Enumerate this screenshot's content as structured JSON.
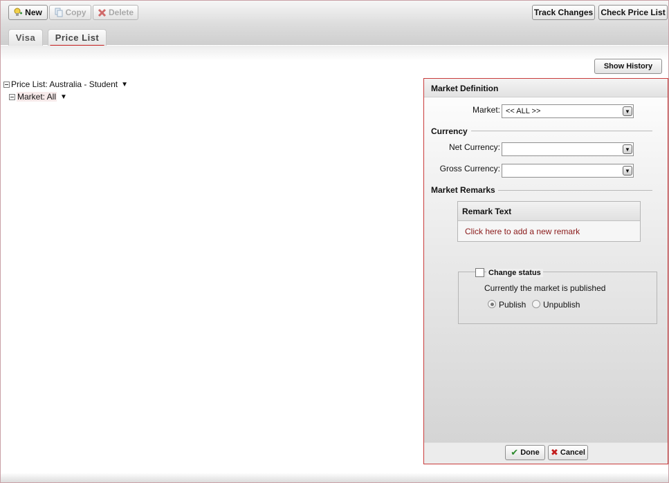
{
  "toolbar": {
    "new_label": "New",
    "copy_label": "Copy",
    "delete_label": "Delete",
    "track_changes_label": "Track Changes",
    "check_price_list_label": "Check Price List"
  },
  "tabs": [
    {
      "label": "Visa",
      "active": false
    },
    {
      "label": "Price List",
      "active": true
    }
  ],
  "show_history_label": "Show History",
  "tree": {
    "root_label": "Price List: Australia - Student",
    "child_label": "Market: All"
  },
  "panel": {
    "title": "Market Definition",
    "market_label": "Market:",
    "market_value": "<< ALL >>",
    "currency_section": "Currency",
    "net_currency_label": "Net Currency:",
    "net_currency_value": "",
    "gross_currency_label": "Gross Currency:",
    "gross_currency_value": "",
    "remarks_section": "Market Remarks",
    "remark_header": "Remark Text",
    "add_remark_link": "Click here to add a new remark",
    "change_status_label": "Change status",
    "change_status_checked": false,
    "status_text": "Currently the market is published",
    "publish_label": "Publish",
    "unpublish_label": "Unpublish",
    "selected_status": "Publish",
    "done_label": "Done",
    "cancel_label": "Cancel"
  },
  "colors": {
    "accent_red": "#c41a1a",
    "panel_border": "#c83a3a",
    "link": "#8a1a1a"
  }
}
